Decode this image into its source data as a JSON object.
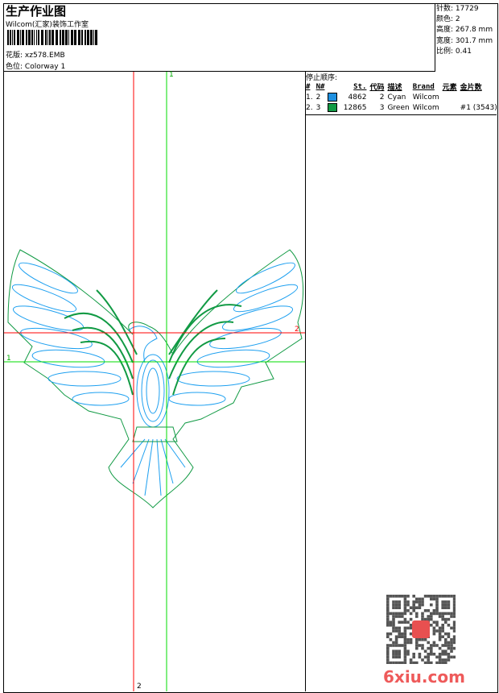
{
  "header": {
    "title": "生产作业图",
    "company": "Wilcom(汇家)装饰工作室",
    "design_label": "花版:",
    "design_value": "xz578.EMB",
    "colorway_label": "色位:",
    "colorway_value": "Colorway 1"
  },
  "stats": [
    {
      "label": "针数:",
      "value": "17729"
    },
    {
      "label": "颜色:",
      "value": "2"
    },
    {
      "label": "高度:",
      "value": "267.8 mm"
    },
    {
      "label": "宽度:",
      "value": "301.7 mm"
    },
    {
      "label": "比例:",
      "value": "0.41"
    }
  ],
  "stop_sequence": {
    "title": "停止顺序:",
    "columns": [
      "#",
      "N#",
      "St.",
      "代码",
      "描述",
      "Brand",
      "元素",
      "金片数"
    ],
    "rows": [
      {
        "idx": "1.",
        "n": "2",
        "color": "#1e90e0",
        "stitches": "4862",
        "code": "2",
        "desc": "Cyan",
        "brand": "Wilcom",
        "element": "",
        "sequins": ""
      },
      {
        "idx": "2.",
        "n": "3",
        "color": "#119a44",
        "stitches": "12865",
        "code": "3",
        "desc": "Green",
        "brand": "Wilcom",
        "element": "",
        "sequins": "#1 (3543)"
      }
    ]
  },
  "crosshair_labels": {
    "green": "1",
    "red": "2"
  },
  "colors": {
    "red": "#ff0000",
    "green": "#00dd00",
    "cyan": "#1ea0f0",
    "green_thread": "#119a44"
  },
  "watermark": "6xiu.com"
}
